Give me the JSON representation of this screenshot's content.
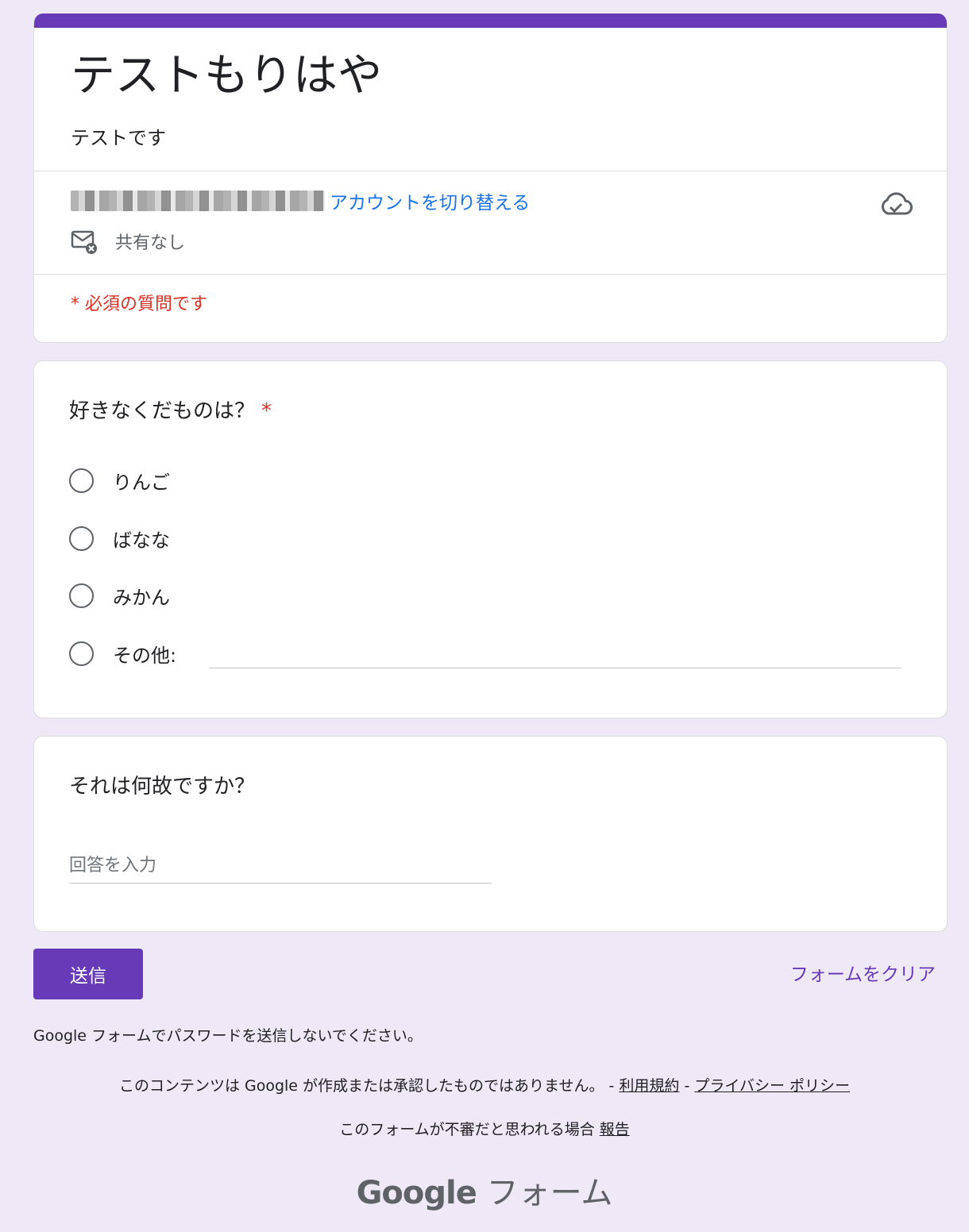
{
  "form": {
    "title": "テストもりはや",
    "description": "テストです",
    "account_switch": "アカウントを切り替える",
    "share_status": "共有なし",
    "required_note": "* 必須の質問です"
  },
  "q1": {
    "title": "好きなくだものは？",
    "required_mark": "*",
    "options": [
      "りんご",
      "ばなな",
      "みかん",
      "その他:"
    ]
  },
  "q2": {
    "title": "それは何故ですか？",
    "placeholder": "回答を入力"
  },
  "actions": {
    "submit": "送信",
    "clear": "フォームをクリア"
  },
  "footer": {
    "password_warning": "Google フォームでパスワードを送信しないでください。",
    "disclaimer": "このコンテンツは Google が作成または承認したものではありません。 -",
    "terms": "利用規約",
    "sep": "-",
    "privacy": "プライバシー ポリシー",
    "suspicious": "このフォームが不審だと思われる場合",
    "report": "報告",
    "brand_google": "Google",
    "brand_forms": "フォーム"
  },
  "colors": {
    "accent": "#673ab7",
    "link": "#1a73e8",
    "required": "#d93025",
    "background": "#efe8f6"
  }
}
